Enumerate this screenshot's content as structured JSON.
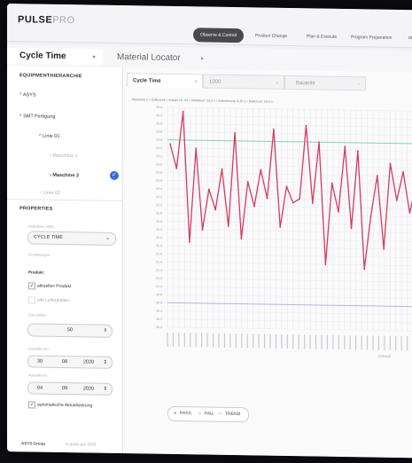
{
  "app": {
    "brand_main": "PULSE",
    "brand_sub": "PRO"
  },
  "nav": [
    "Observe & Control",
    "Product Change",
    "Plan & Execute",
    "Program Preparation",
    "Materi"
  ],
  "tabs": {
    "active": "Cycle Time",
    "second": "Material Locator"
  },
  "sidebar": {
    "hierarchy_title": "EQUIPMENTHIERARCHIE",
    "items": [
      "ASYS",
      "SMT Fertigung",
      "Linie 01",
      "Maschine 1",
      "Maschine 2",
      "Linie 02"
    ],
    "properties_title": "PROPERTIES",
    "evaluation_label": "evaluation editor",
    "evaluation_value": "CYCLE TIME",
    "settings_label": "Einstellungen",
    "product_label": "Produkt",
    "opt1": "aktuelles Produkt",
    "opt2": "alle Leiterplatten",
    "count_label": "Zeit wählen",
    "count_value": "50",
    "from_label": "Auswahl von",
    "from": [
      "30",
      "08",
      "2020"
    ],
    "to_label": "Auswahl bis",
    "to": [
      "04",
      "09",
      "2020"
    ],
    "auto_label": "automatische Aktualisierung",
    "footer_left": "ASYS Group",
    "footer_right": "© pulse pro 2020"
  },
  "chart_tabs": [
    "Cycle Time",
    "1000",
    "Bauteile"
  ],
  "chart_subtitle": "Maschine 2 > Zykluszeit > Anzahl LP: 50 > Mittelwert: 33,4 s > Abweichung: 0,25 s > Maximum: 35,8 s",
  "legend": {
    "pass": "PASS",
    "fail": "FAIL",
    "trend": "TREND"
  },
  "x_axis_label": "Zeitraum",
  "colors": {
    "series": "#d63a5c",
    "mean": "#7fd6b4",
    "limit": "#b9b2e6",
    "accent": "#2f6fe0"
  },
  "chart_data": {
    "type": "line",
    "y_ticks": [
      "35.4",
      "35.2",
      "35.0",
      "34.8",
      "34.6",
      "34.4",
      "34.2",
      "34.0",
      "33.8",
      "33.6",
      "33.4",
      "33.2",
      "33.0",
      "32.8",
      "32.6",
      "32.4",
      "32.2",
      "32.0",
      "31.8",
      "31.6",
      "31.4",
      "31.2",
      "31.0",
      "30.8",
      "30.6",
      "30.4",
      "30.2",
      "30.0"
    ],
    "ylim": [
      30.0,
      35.4
    ],
    "mean": 34.6,
    "lower_limit": 30.6,
    "values": [
      34.5,
      33.9,
      35.3,
      32.1,
      34.4,
      32.4,
      33.4,
      32.9,
      33.9,
      32.5,
      34.8,
      32.2,
      33.6,
      33.0,
      33.9,
      33.2,
      34.9,
      32.5,
      33.5,
      33.1,
      33.2,
      35.0,
      33.1,
      34.6,
      31.6,
      33.6,
      32.9,
      34.5,
      32.5,
      34.4,
      31.5,
      32.8,
      33.8,
      32.0,
      34.1,
      33.2,
      33.9,
      32.9,
      33.6,
      33.3
    ]
  }
}
